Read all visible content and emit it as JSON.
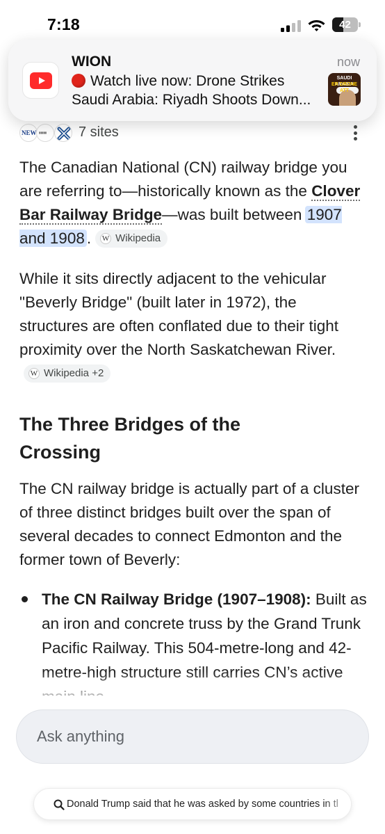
{
  "status_bar": {
    "time": "7:18",
    "battery_level": "42",
    "battery_fraction": 0.42,
    "icons": [
      "signal-icon",
      "wifi-icon",
      "battery-icon"
    ]
  },
  "notification": {
    "app_icon": "youtube-icon",
    "title": "WION",
    "time": "now",
    "line1": "Watch live now: Drone Strikes",
    "line2": "Saudi Arabia: Riyadh Shoots Down...",
    "thumbnail_text_top": "SAUDI ARABIA",
    "thumbnail_text_bottom": "ER DRONE ATT"
  },
  "sources": {
    "label": "7 sites",
    "icons": [
      "news-source-icon",
      "university-source-icon",
      "cross-logo-source-icon"
    ],
    "news_icon_text": "NEWS"
  },
  "answer": {
    "para1": {
      "text_a": "The Canadian National (CN) railway bridge you are referring to—historically known as the ",
      "entity": "Clover Bar Railway Bridge",
      "text_b": "—was built between ",
      "highlight": "1907 and 1908",
      "text_c": ".",
      "chip": "Wikipedia"
    },
    "para2": {
      "text": "While it sits directly adjacent to the vehicular \"Beverly Bridge\" (built later in 1972), the structures are often conflated due to their tight proximity over the North Saskatchewan River.",
      "chip": "Wikipedia +2"
    },
    "heading": "The Three Bridges of the Crossing",
    "para3": "The CN railway bridge is actually part of a cluster of three distinct bridges built over the span of several decades to connect Edmonton and the former town of Beverly:",
    "bullets": [
      {
        "title": "The CN Railway Bridge (1907–1908):",
        "text": " Built as an iron and concrete truss by the Grand Trunk Pacific Railway. This 504-metre-long and 42-metre-high structure still carries CN’s active main line."
      }
    ]
  },
  "ask": {
    "placeholder": "Ask anything"
  },
  "suggestion": {
    "text": "Donald Trump said that he was asked by some countries in the"
  },
  "colors": {
    "highlight": "#d3e3fd",
    "youtube_red": "#ff2b2b",
    "chip_bg": "#f1f3f4",
    "ask_bar_bg": "#eef0f4"
  }
}
